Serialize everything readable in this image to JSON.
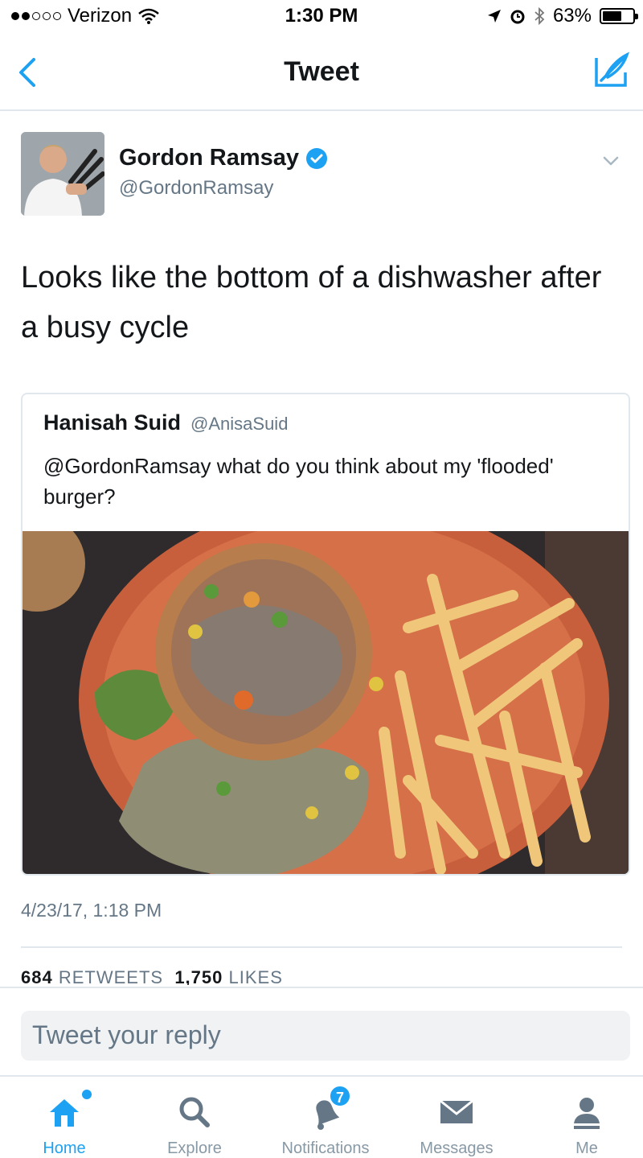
{
  "status_bar": {
    "carrier": "Verizon",
    "time": "1:30 PM",
    "battery_percent": "63%",
    "battery_level": 0.63,
    "icons": [
      "signal-dots-icon",
      "wifi-icon",
      "location-arrow-icon",
      "alarm-icon",
      "bluetooth-icon",
      "battery-icon"
    ]
  },
  "nav": {
    "title": "Tweet",
    "back_icon": "chevron-left-icon",
    "compose_icon": "compose-feather-icon"
  },
  "tweet": {
    "author_name": "Gordon Ramsay",
    "author_handle": "@GordonRamsay",
    "verified": true,
    "text": "Looks like the bottom of a dishwasher after a busy cycle",
    "timestamp": "4/23/17, 1:18 PM",
    "retweets": "684",
    "retweets_label": "RETWEETS",
    "likes": "1,750",
    "likes_label": "LIKES"
  },
  "quoted_tweet": {
    "author_name": "Hanisah Suid",
    "author_handle": "@AnisaSuid",
    "text": "@GordonRamsay what do you think about my 'flooded' burger?"
  },
  "reply": {
    "placeholder": "Tweet your reply"
  },
  "tabs": [
    {
      "label": "Home",
      "icon": "home-icon",
      "active": true
    },
    {
      "label": "Explore",
      "icon": "search-icon",
      "active": false
    },
    {
      "label": "Notifications",
      "icon": "bell-icon",
      "active": false,
      "badge": "7"
    },
    {
      "label": "Messages",
      "icon": "envelope-icon",
      "active": false
    },
    {
      "label": "Me",
      "icon": "person-icon",
      "active": false
    }
  ],
  "colors": {
    "accent": "#1da1f2",
    "secondary_text": "#657786",
    "border": "#e1e8ed"
  }
}
